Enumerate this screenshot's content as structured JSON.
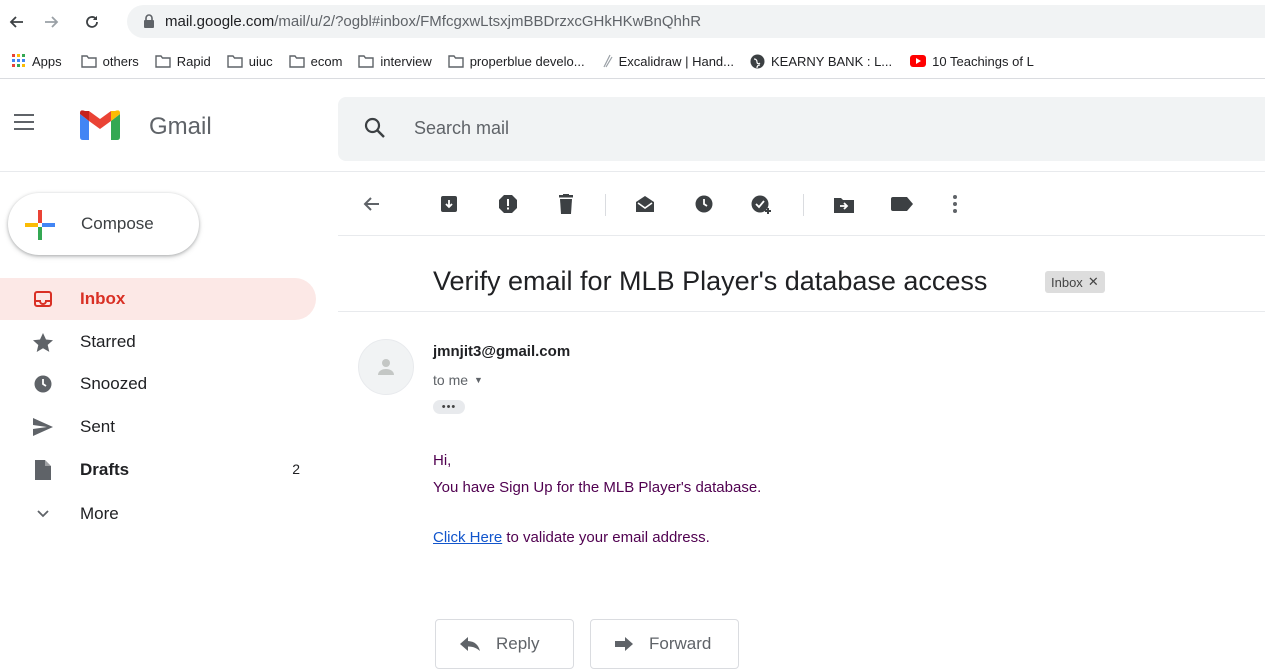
{
  "browser": {
    "url_host": "mail.google.com",
    "url_path": "/mail/u/2/?ogbl#inbox/FMfcgxwLtsxjmBBDrzxcGHkHKwBnQhhR",
    "bookmarks": [
      "Apps",
      "others",
      "Rapid",
      "uiuc",
      "ecom",
      "interview",
      "properblue develo...",
      "Excalidraw | Hand...",
      "KEARNY BANK : L...",
      "10 Teachings of L"
    ]
  },
  "header": {
    "app_name": "Gmail",
    "search_placeholder": "Search mail"
  },
  "compose": {
    "label": "Compose"
  },
  "sidebar": {
    "items": [
      {
        "label": "Inbox",
        "icon": "inbox-icon",
        "active": true
      },
      {
        "label": "Starred",
        "icon": "star-icon"
      },
      {
        "label": "Snoozed",
        "icon": "clock-icon"
      },
      {
        "label": "Sent",
        "icon": "send-icon"
      },
      {
        "label": "Drafts",
        "icon": "draft-icon",
        "count": "2"
      },
      {
        "label": "More",
        "icon": "chevron-down-icon"
      }
    ]
  },
  "message": {
    "subject": "Verify email for MLB Player's database access",
    "label_chip": "Inbox",
    "sender": "jmnjit3@gmail.com",
    "recipient": "to me",
    "body": {
      "greeting": "Hi,",
      "line1": "You have Sign Up for the MLB Player's database.",
      "link_text": "Click Here",
      "line2_rest": " to validate your email address."
    }
  },
  "actions": {
    "reply": "Reply",
    "forward": "Forward"
  },
  "colors": {
    "gmail_red": "#d93025",
    "active_bg": "#fce8e6",
    "body_text": "#500050",
    "link": "#1155cc"
  }
}
